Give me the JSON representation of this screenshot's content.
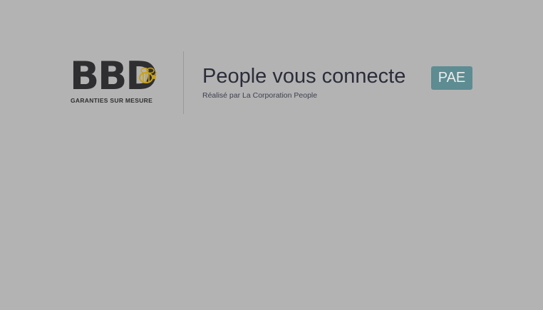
{
  "logo": {
    "brand_letters": "BBD",
    "tagline": "GARANTIES SUR MESURE",
    "icon": "bee-icon"
  },
  "header": {
    "title": "People vous connecte",
    "badge": "PAE",
    "subtitle": "Réalisé par La Corporation People"
  },
  "colors": {
    "background": "#b3b3b3",
    "badge_bg": "#5d8c92",
    "text_dark": "#2b2d3a",
    "bee_yellow": "#c9a21a"
  }
}
